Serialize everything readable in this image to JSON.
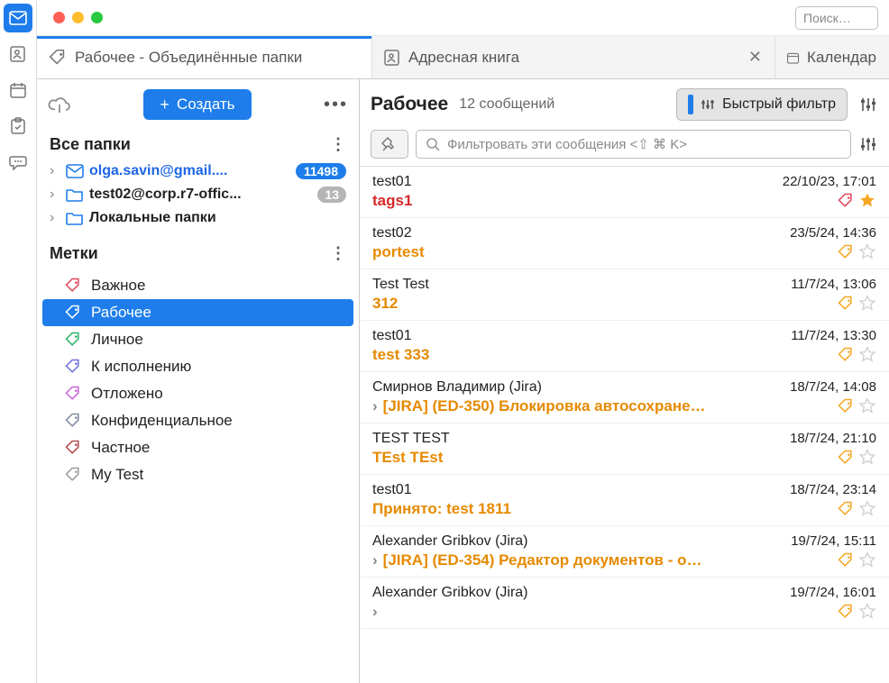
{
  "titlebar": {
    "search_placeholder": "Поиск…"
  },
  "tabs": {
    "main_label": "Рабочее - Объединённые папки",
    "addressbook_label": "Адресная книга",
    "calendar_label": "Календар"
  },
  "sidebar": {
    "create_label": "Создать",
    "all_folders_label": "Все папки",
    "folders": [
      {
        "name": "olga.savin@gmail....",
        "count": "11498",
        "primary": true
      },
      {
        "name": "test02@corp.r7-offic...",
        "count": "13",
        "primary": false
      },
      {
        "name": "Локальные папки",
        "count": "",
        "primary": false
      }
    ],
    "tags_label": "Метки",
    "tags": [
      {
        "label": "Важное",
        "color": "#e0465b",
        "active": false
      },
      {
        "label": "Рабочее",
        "color": "#ffffff",
        "active": true
      },
      {
        "label": "Личное",
        "color": "#2cb36a",
        "active": false
      },
      {
        "label": "К исполнению",
        "color": "#6f6fe0",
        "active": false
      },
      {
        "label": "Отложено",
        "color": "#c565d8",
        "active": false
      },
      {
        "label": "Конфиденциальное",
        "color": "#7d8aa0",
        "active": false
      },
      {
        "label": "Частное",
        "color": "#b34a4a",
        "active": false
      },
      {
        "label": "My Test",
        "color": "#9a9a9a",
        "active": false
      }
    ]
  },
  "listHeader": {
    "title": "Рабочее",
    "count_label": "12 сообщений",
    "quick_filter_label": "Быстрый фильтр",
    "filter_placeholder": "Фильтровать эти сообщения <⇧ ⌘ K>"
  },
  "messages": [
    {
      "sender": "test01",
      "date": "22/10/23, 17:01",
      "subject": "tags1",
      "subjColor": "red",
      "tagColor": "#e0465b",
      "starred": true,
      "thread": false
    },
    {
      "sender": "test02",
      "date": "23/5/24, 14:36",
      "subject": "portest",
      "subjColor": "orange",
      "tagColor": "#f5a623",
      "starred": false,
      "thread": false
    },
    {
      "sender": "Test Test",
      "date": "11/7/24, 13:06",
      "subject": "312",
      "subjColor": "orange",
      "tagColor": "#f5a623",
      "starred": false,
      "thread": false
    },
    {
      "sender": "test01",
      "date": "11/7/24, 13:30",
      "subject": "test 333",
      "subjColor": "orange",
      "tagColor": "#f5a623",
      "starred": false,
      "thread": false
    },
    {
      "sender": "Смирнов Владимир (Jira)",
      "date": "18/7/24, 14:08",
      "subject": "[JIRA] (ED-350) Блокировка автосохране…",
      "subjColor": "orange",
      "tagColor": "#f5a623",
      "starred": false,
      "thread": true
    },
    {
      "sender": "TEST TEST",
      "date": "18/7/24, 21:10",
      "subject": "TEst TEst",
      "subjColor": "orange",
      "tagColor": "#f5a623",
      "starred": false,
      "thread": false
    },
    {
      "sender": "test01",
      "date": "18/7/24, 23:14",
      "subject": "Принято: test 1811",
      "subjColor": "orange",
      "tagColor": "#f5a623",
      "starred": false,
      "thread": false
    },
    {
      "sender": "Alexander Gribkov (Jira)",
      "date": "19/7/24, 15:11",
      "subject": "[JIRA] (ED-354) Редактор документов - о…",
      "subjColor": "orange",
      "tagColor": "#f5a623",
      "starred": false,
      "thread": true
    },
    {
      "sender": "Alexander Gribkov (Jira)",
      "date": "19/7/24, 16:01",
      "subject": "",
      "subjColor": "orange",
      "tagColor": "#f5a623",
      "starred": false,
      "thread": true
    }
  ]
}
